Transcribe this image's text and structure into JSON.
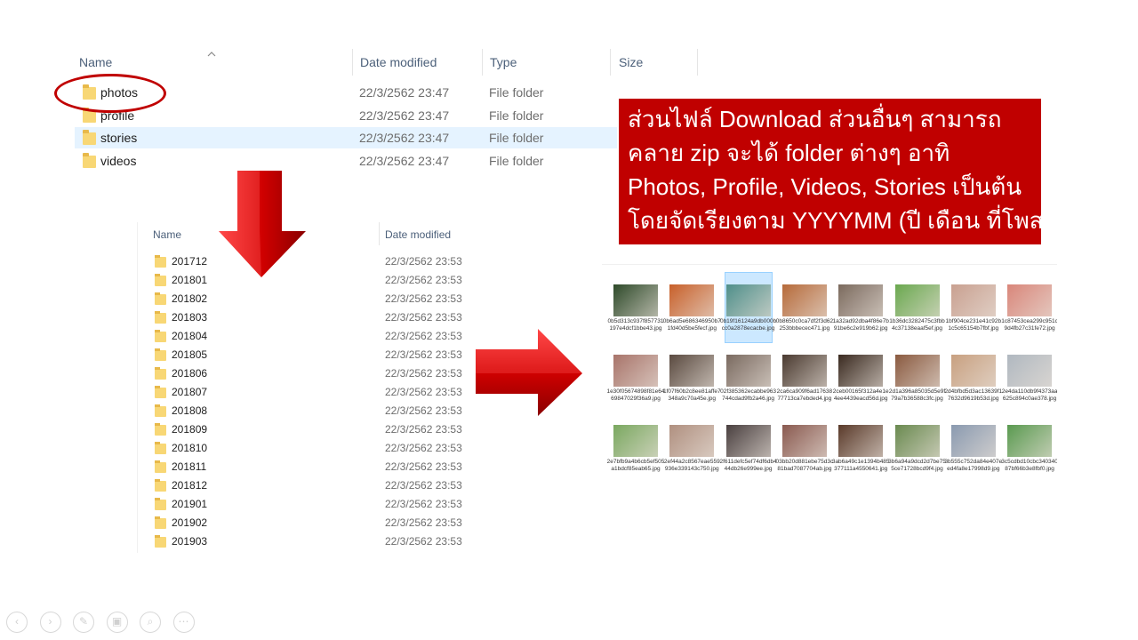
{
  "top_explorer": {
    "headers": {
      "name": "Name",
      "date": "Date modified",
      "type": "Type",
      "size": "Size"
    },
    "rows": [
      {
        "name": "photos",
        "date": "22/3/2562 23:47",
        "type": "File folder"
      },
      {
        "name": "profile",
        "date": "22/3/2562 23:47",
        "type": "File folder"
      },
      {
        "name": "stories",
        "date": "22/3/2562 23:47",
        "type": "File folder"
      },
      {
        "name": "videos",
        "date": "22/3/2562 23:47",
        "type": "File folder"
      }
    ]
  },
  "callout": {
    "lines": [
      "ส่วนไฟล์ Download ส่วนอื่นๆ สามารถ",
      "คลาย zip จะได้ folder ต่างๆ อาทิ",
      "Photos, Profile, Videos, Stories เป็นต้น",
      "โดยจัดเรียงตาม YYYYMM (ปี เดือน ที่โพส)"
    ]
  },
  "sub_explorer": {
    "headers": {
      "name": "Name",
      "date": "Date modified"
    },
    "rows": [
      {
        "name": "201712",
        "date": "22/3/2562 23:53"
      },
      {
        "name": "201801",
        "date": "22/3/2562 23:53"
      },
      {
        "name": "201802",
        "date": "22/3/2562 23:53"
      },
      {
        "name": "201803",
        "date": "22/3/2562 23:53"
      },
      {
        "name": "201804",
        "date": "22/3/2562 23:53"
      },
      {
        "name": "201805",
        "date": "22/3/2562 23:53"
      },
      {
        "name": "201806",
        "date": "22/3/2562 23:53"
      },
      {
        "name": "201807",
        "date": "22/3/2562 23:53"
      },
      {
        "name": "201808",
        "date": "22/3/2562 23:53"
      },
      {
        "name": "201809",
        "date": "22/3/2562 23:53"
      },
      {
        "name": "201810",
        "date": "22/3/2562 23:53"
      },
      {
        "name": "201811",
        "date": "22/3/2562 23:53"
      },
      {
        "name": "201812",
        "date": "22/3/2562 23:53"
      },
      {
        "name": "201901",
        "date": "22/3/2562 23:53"
      },
      {
        "name": "201902",
        "date": "22/3/2562 23:53"
      },
      {
        "name": "201903",
        "date": "22/3/2562 23:53"
      }
    ]
  },
  "thumbnails": [
    {
      "caption": "0b5d313c937f857731197e4dcf1bbe43.jpg",
      "color": "#2e4a2a"
    },
    {
      "caption": "0b6ad5e686346950b71fd40d5be5fecf.jpg",
      "color": "#c8602a"
    },
    {
      "caption": "0b19f16124a9db000bcc0a2878ecacbe.jpg",
      "color": "#4f8f8a"
    },
    {
      "caption": "0b8650c0ca7df2f3d62253bbbecec471.jpg",
      "color": "#b66a3a"
    },
    {
      "caption": "1a32ad92dba4f86e7b91be6c2e919b62.jpg",
      "color": "#7b6a5e"
    },
    {
      "caption": "1b36dc3282475c3fbb4c37138eaaf5ef.jpg",
      "color": "#6aa84f"
    },
    {
      "caption": "1bf904ce231e41c92b1c5c65154b7fbf.jpg",
      "color": "#c9a090"
    },
    {
      "caption": "1c87453cea299c951c9d4fb27c31fe72.jpg",
      "color": "#d9867a"
    },
    {
      "caption": "1e30f05674898f81e6469847029f36a9.jpg",
      "color": "#a8746a"
    },
    {
      "caption": "1f07f60b2c8ee81affe7348a9c70a45e.jpg",
      "color": "#5a4a40"
    },
    {
      "caption": "02f385362ecabbe963744cdad9fb2a46.jpg",
      "color": "#7a6a60"
    },
    {
      "caption": "2ca6ca909f6ad1763877713ca7ebded4.jpg",
      "color": "#4a3a30"
    },
    {
      "caption": "2ceb00165f312a4e1e4ee4439eacd56d.jpg",
      "color": "#3a2a20"
    },
    {
      "caption": "2d1a396a85035d5e9f79a7b36588c3fc.jpg",
      "color": "#8a5a40"
    },
    {
      "caption": "2d4bfbd5d3ac13639f17632d9619b53d.jpg",
      "color": "#c8a080"
    },
    {
      "caption": "2e4da110db9f4373aa625c894c0ae378.jpg",
      "color": "#b0b8c0"
    },
    {
      "caption": "2e7bfb9a4b6cb5ef505a1bdcf85eab65.jpg",
      "color": "#7aa860"
    },
    {
      "caption": "2ef44a2c8567eae559936e339143c750.jpg",
      "color": "#b09080"
    },
    {
      "caption": "2f611defc5ef74df6db444db26e999ee.jpg",
      "color": "#4a4040"
    },
    {
      "caption": "03bb20d881ebe75d3c81bad7087704ab.jpg",
      "color": "#8a5a50"
    },
    {
      "caption": "3ab6a49c1e1394b485377111a4550641.jpg",
      "color": "#5a3a2a"
    },
    {
      "caption": "3b6a94a9dcd2d7be755ce71728bcd9f4.jpg",
      "color": "#6a8a50"
    },
    {
      "caption": "3b555c752da84e407eed4fa8e17998d9.jpg",
      "color": "#8a9ab0"
    },
    {
      "caption": "3c5cdbd10cbc34034087bf66b3e8fbf0.jpg",
      "color": "#5a9a50"
    }
  ],
  "toolbar": {
    "icons": [
      "previous-icon",
      "next-icon",
      "pen-icon",
      "slides-icon",
      "zoom-icon",
      "more-icon"
    ]
  }
}
